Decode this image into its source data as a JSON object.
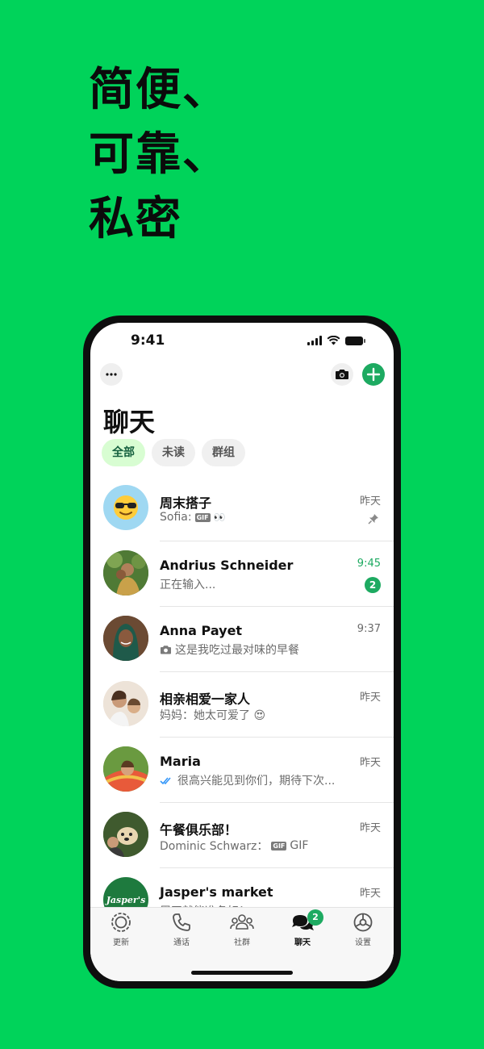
{
  "headline": [
    "简便、",
    "可靠、",
    "私密"
  ],
  "status": {
    "time": "9:41"
  },
  "header": {
    "title": "聊天",
    "more_icon": "more-dots-icon",
    "camera_icon": "camera-icon",
    "add_icon": "plus-icon"
  },
  "filters": [
    {
      "label": "全部",
      "active": true
    },
    {
      "label": "未读",
      "active": false
    },
    {
      "label": "群组",
      "active": false
    }
  ],
  "chats": [
    {
      "name": "周末搭子",
      "sender": "Sofia:",
      "gif_tag": "GIF",
      "preview": "👀",
      "time": "昨天",
      "pinned": true
    },
    {
      "name": "Andrius Schneider",
      "preview": "正在输入...",
      "time": "9:45",
      "unread_count": "2"
    },
    {
      "name": "Anna Payet",
      "preview": "这是我吃过最对味的早餐",
      "time": "9:37",
      "has_photo_icon": true
    },
    {
      "name": "相亲相爱一家人",
      "preview": "妈妈：她太可爱了 😍",
      "time": "昨天"
    },
    {
      "name": "Maria",
      "preview": "很高兴能见到你们，期待下次...",
      "time": "昨天",
      "read_ticks": true
    },
    {
      "name": "午餐俱乐部！",
      "sender": "Dominic Schwarz：",
      "gif_tag": "GIF",
      "preview": "GIF",
      "time": "昨天"
    },
    {
      "name": "Jasper's market",
      "preview": "周四就能准备好！",
      "time": "昨天",
      "avatar_text": "Jasper's"
    }
  ],
  "tabs": [
    {
      "label": "更新",
      "icon": "updates-icon"
    },
    {
      "label": "通话",
      "icon": "phone-icon"
    },
    {
      "label": "社群",
      "icon": "communities-icon"
    },
    {
      "label": "聊天",
      "icon": "chats-icon",
      "active": true,
      "badge": "2"
    },
    {
      "label": "设置",
      "icon": "settings-icon"
    }
  ],
  "colors": {
    "background": "#00D35A",
    "accent": "#1DAA61",
    "chip_active_bg": "#D8FDD2"
  }
}
